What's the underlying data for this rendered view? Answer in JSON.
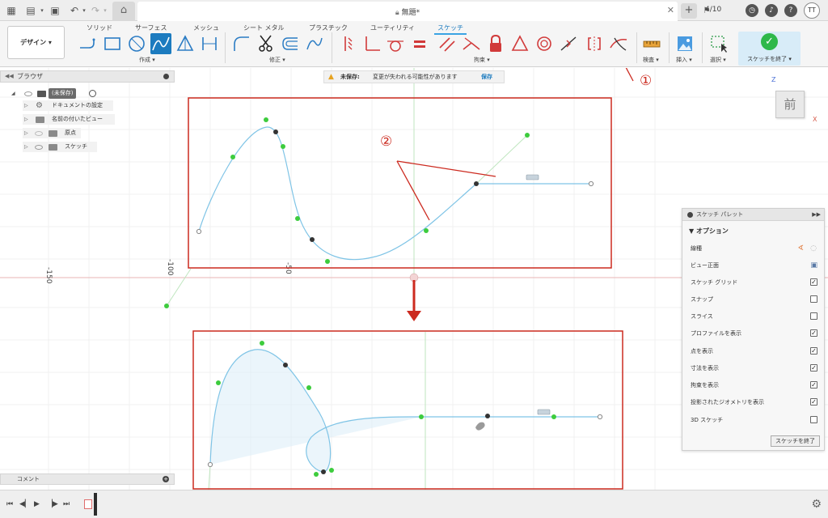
{
  "topbar": {
    "doc_title": "無題*",
    "job_count": "4/10",
    "avatar": "TT",
    "icons": [
      "grid-icon",
      "file-icon",
      "save-icon",
      "undo-icon",
      "redo-icon",
      "home-icon",
      "lock-icon",
      "close-icon",
      "plus-icon",
      "clock-icon",
      "bell-icon",
      "help-icon"
    ]
  },
  "toolbar": {
    "design_label": "デザイン",
    "tabs": [
      "ソリッド",
      "サーフェス",
      "メッシュ",
      "シート メタル",
      "プラスチック",
      "ユーティリティ",
      "スケッチ"
    ],
    "groups": {
      "create": "作成",
      "modify": "修正",
      "constraints": "拘束",
      "inspect": "検査",
      "insert": "挿入",
      "select": "選択"
    },
    "finish_sketch": "スケッチを終了"
  },
  "unsaved": {
    "label": "未保存:",
    "message": "変更が失われる可能性があります",
    "save": "保存"
  },
  "browser": {
    "title": "ブラウザ",
    "root": "(未保存)",
    "items": [
      "ドキュメントの設定",
      "名前の付いたビュー",
      "原点",
      "スケッチ"
    ]
  },
  "comments": {
    "title": "コメント"
  },
  "palette": {
    "title": "スケッチ パレット",
    "options_title": "オプション",
    "options": [
      {
        "label": "線種",
        "type": "icons"
      },
      {
        "label": "ビュー正面",
        "type": "icon"
      },
      {
        "label": "スケッチ グリッド",
        "checked": true
      },
      {
        "label": "スナップ",
        "checked": false
      },
      {
        "label": "スライス",
        "checked": false
      },
      {
        "label": "プロファイルを表示",
        "checked": true
      },
      {
        "label": "点を表示",
        "checked": true
      },
      {
        "label": "寸法を表示",
        "checked": true
      },
      {
        "label": "拘束を表示",
        "checked": true
      },
      {
        "label": "投影されたジオメトリを表示",
        "checked": true
      },
      {
        "label": "3D スケッチ",
        "checked": false
      }
    ],
    "finish_button": "スケッチを終了"
  },
  "viewcube": {
    "face": "前",
    "axis_z": "Z",
    "axis_x": "X"
  },
  "canvas": {
    "ruler_labels": [
      "-150",
      "-100",
      "-50"
    ]
  },
  "annotations": {
    "marker1": "①",
    "marker2": "②"
  },
  "colors": {
    "accent": "#3aa3e3",
    "annotation": "#cc2a1f",
    "curve": "#7fc4e6",
    "point_green": "#3dcc3d",
    "finish_green": "#2eb84a"
  }
}
